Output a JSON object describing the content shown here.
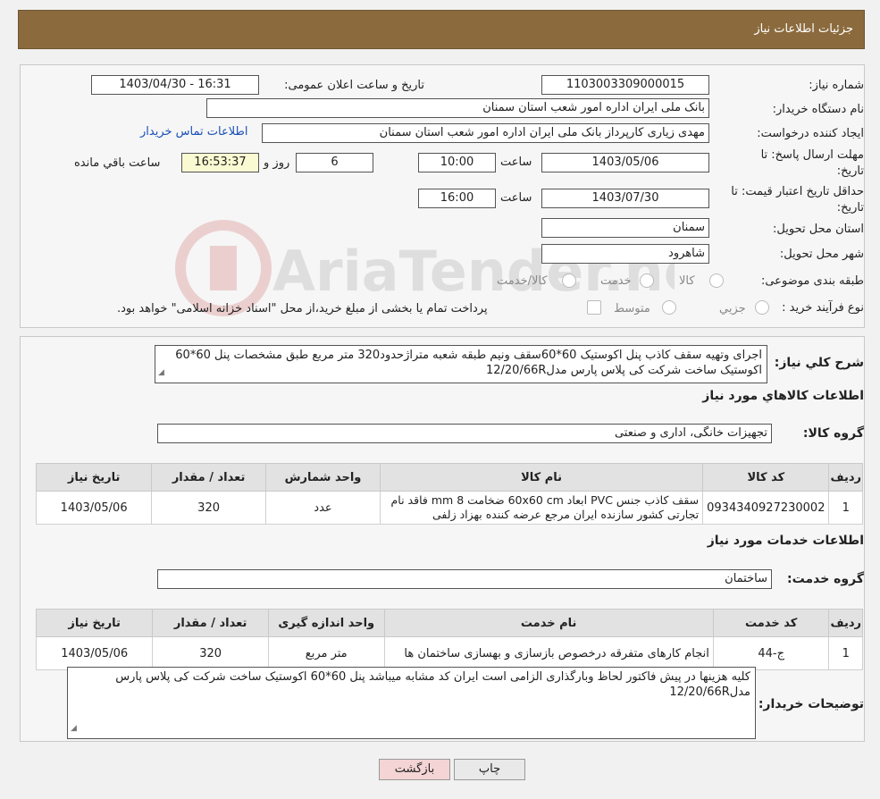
{
  "header": {
    "title": "جزئیات اطلاعات نیاز"
  },
  "form": {
    "need_number_label": "شماره نیاز:",
    "need_number": "1103003309000015",
    "announce_label": "تاریخ و ساعت اعلان عمومی:",
    "announce_value": "1403/04/30 - 16:31",
    "buyer_org_label": "نام دستگاه خریدار:",
    "buyer_org": "بانک ملی ایران اداره امور شعب استان سمنان",
    "creator_label": "ایجاد کننده درخواست:",
    "creator": "مهدی زیاری کارپرداز بانک ملی ایران اداره امور شعب استان سمنان",
    "contact_link": "اطلاعات تماس خریدار",
    "deadline_label": "مهلت ارسال پاسخ: تا تاریخ:",
    "deadline_date": "1403/05/06",
    "time_label": "ساعت",
    "deadline_time": "10:00",
    "days_value": "6",
    "days_label": "روز و",
    "remaining_time": "16:53:37",
    "remaining_label": "ساعت باقي مانده",
    "validity_label": "حداقل تاریخ اعتبار قیمت: تا تاریخ:",
    "validity_date": "1403/07/30",
    "validity_time": "16:00",
    "province_label": "استان محل تحویل:",
    "province": "سمنان",
    "city_label": "شهر محل تحویل:",
    "city": "شاهرود",
    "category_label": "طبقه بندی موضوعی:",
    "category_options": [
      "کالا",
      "خدمت",
      "کالا/خدمت"
    ],
    "process_label": "نوع فرآیند خرید :",
    "process_options": [
      "جزيي",
      "متوسط"
    ],
    "process_note": "پرداخت تمام یا بخشی از مبلغ خرید،از محل \"اسناد خزانه اسلامی\" خواهد بود."
  },
  "summary": {
    "label": "شرح کلي نياز:",
    "text": "اجرای وتهیه سقف کاذب  پنل اکوستیک 60*60سقف ونیم طبقه شعبه متراژحدود320 متر مربع   طبق مشخصات   پنل 60*60 اکوستیک ساخت شرکت کی پلاس پارس مدل12/20/66R"
  },
  "goods": {
    "section_title": "اطلاعات کالاهاي مورد نياز",
    "group_label": "گروه کالا:",
    "group_value": "تجهیزات خانگی، اداری و صنعتی",
    "headers": [
      "رديف",
      "کد کالا",
      "نام کالا",
      "واحد شمارش",
      "تعداد / مقدار",
      "تاريخ نياز"
    ],
    "rows": [
      {
        "row": "1",
        "code": "0934340927230002",
        "name": "سقف کاذب جنس PVC ابعاد 60x60 cm ضخامت 8 mm فاقد نام تجارتی کشور سازنده ایران مرجع عرضه کننده بهزاد زلفی",
        "unit": "عدد",
        "qty": "320",
        "date": "1403/05/06"
      }
    ]
  },
  "services": {
    "section_title": "اطلاعات خدمات مورد نياز",
    "group_label": "گروه خدمت:",
    "group_value": "ساختمان",
    "headers": [
      "رديف",
      "کد خدمت",
      "نام خدمت",
      "واحد اندازه گیری",
      "تعداد / مقدار",
      "تاريخ نياز"
    ],
    "rows": [
      {
        "row": "1",
        "code": "ج-44",
        "name": "انجام کارهای متفرقه درخصوص بازسازی و بهسازی ساختمان ها",
        "unit": "متر مربع",
        "qty": "320",
        "date": "1403/05/06"
      }
    ]
  },
  "buyer_notes": {
    "label": "توضیحات خریدار:",
    "text": "کلیه هزینها در پیش فاکتور لحاظ وبارگذاری الزامی است ایران کد مشابه میباشد  پنل 60*60 اکوستیک ساخت شرکت کی پلاس پارس مدل12/20/66R"
  },
  "buttons": {
    "print": "چاپ",
    "back": "بازگشت"
  },
  "watermark": "AriaTender.neT"
}
